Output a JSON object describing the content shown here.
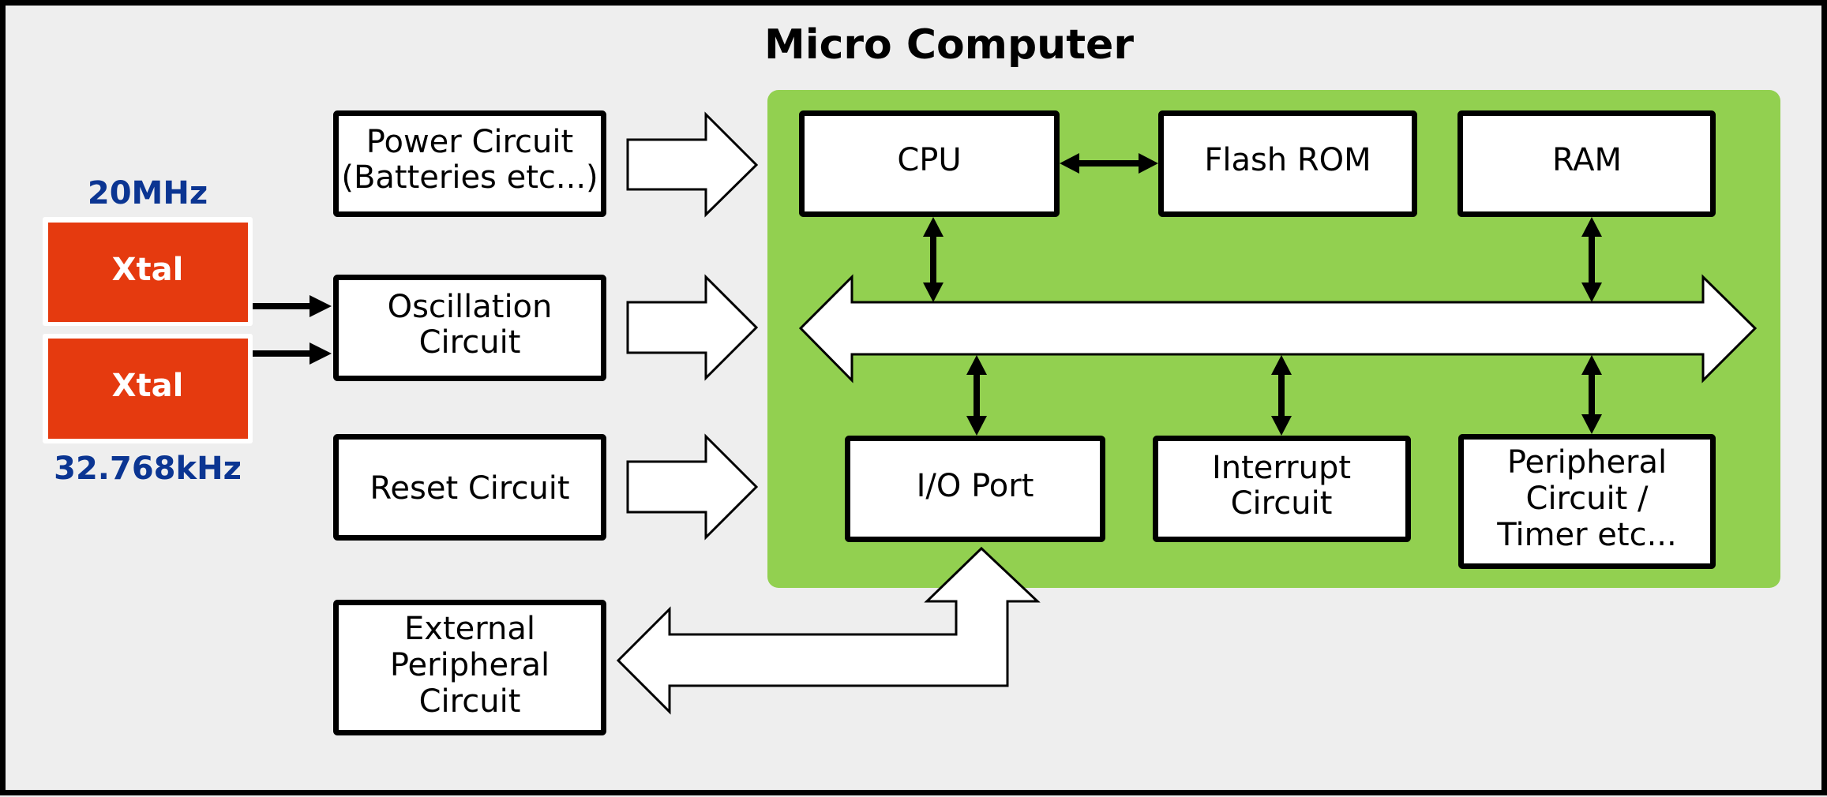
{
  "title": "Micro Computer",
  "colors": {
    "background": "#eeeeee",
    "mcu_fill": "#92d050",
    "xtal_fill": "#e53a0f",
    "freq_text": "#0b3592"
  },
  "crystals": [
    {
      "label": "Xtal",
      "frequency": "20MHz"
    },
    {
      "label": "Xtal",
      "frequency": "32.768kHz"
    }
  ],
  "external_blocks": {
    "power": [
      "Power Circuit",
      "(Batteries etc...)"
    ],
    "oscillation": [
      "Oscillation",
      "Circuit"
    ],
    "reset": [
      "Reset Circuit"
    ],
    "external_peripheral": [
      "External",
      "Peripheral",
      "Circuit"
    ]
  },
  "internal_blocks": {
    "cpu": [
      "CPU"
    ],
    "flash_rom": [
      "Flash ROM"
    ],
    "ram": [
      "RAM"
    ],
    "io_port": [
      "I/O Port"
    ],
    "interrupt": [
      "Interrupt",
      "Circuit"
    ],
    "peripheral": [
      "Peripheral",
      "Circuit /",
      "Timer etc..."
    ]
  }
}
